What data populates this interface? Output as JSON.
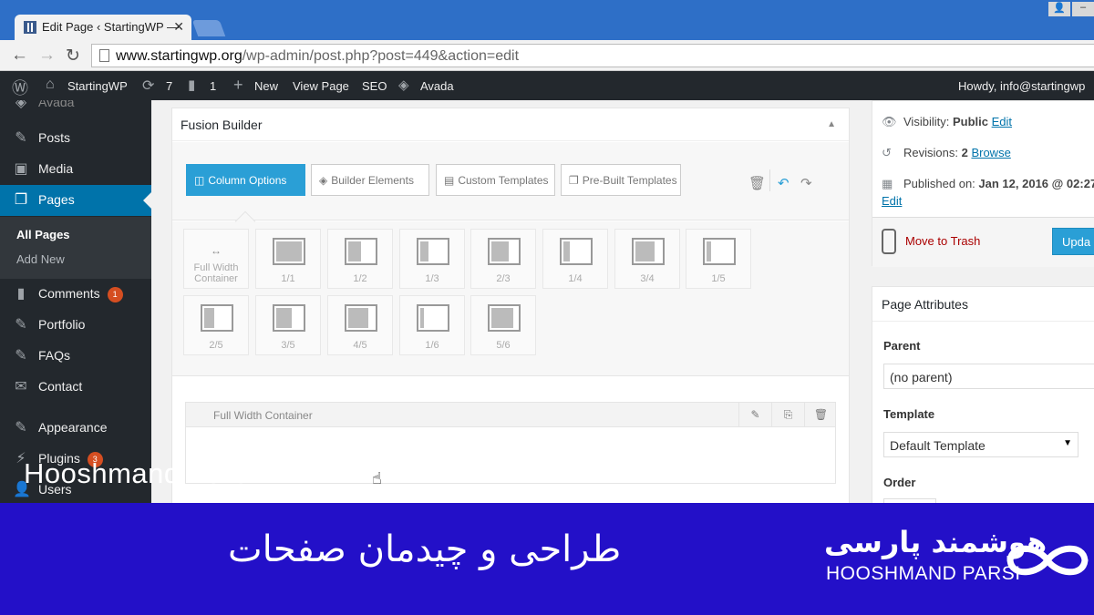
{
  "browser": {
    "tab_title": "Edit Page ‹ StartingWP —",
    "url_domain": "www.startingwp.org",
    "url_path": "/wp-admin/post.php?post=449&action=edit"
  },
  "adminbar": {
    "site": "StartingWP",
    "updates": "7",
    "comments": "1",
    "new": "New",
    "view_page": "View Page",
    "seo": "SEO",
    "avada": "Avada",
    "howdy": "Howdy, info@startingwp"
  },
  "sidebar": {
    "top_cut": "Avada",
    "items": [
      {
        "label": "Posts"
      },
      {
        "label": "Media"
      },
      {
        "label": "Pages"
      },
      {
        "label": "Comments",
        "badge": "1"
      },
      {
        "label": "Portfolio"
      },
      {
        "label": "FAQs"
      },
      {
        "label": "Contact"
      },
      {
        "label": "Appearance"
      },
      {
        "label": "Plugins",
        "badge": "3"
      },
      {
        "label": "Users"
      }
    ],
    "sub_all": "All Pages",
    "sub_add": "Add New"
  },
  "builder": {
    "title": "Fusion Builder",
    "btn_column": "Column Options",
    "btn_elements": "Builder Elements",
    "btn_custom": "Custom Templates",
    "btn_prebuilt": "Pre-Built Templates",
    "full_width_label": "Full Width Container",
    "columns": [
      "1/1",
      "1/2",
      "1/3",
      "2/3",
      "1/4",
      "3/4",
      "1/5",
      "2/5",
      "3/5",
      "4/5",
      "1/6",
      "5/6"
    ],
    "container_label": "Full Width Container"
  },
  "publish": {
    "visibility_label": "Visibility:",
    "visibility_value": "Public",
    "visibility_edit": "Edit",
    "revisions_label": "Revisions:",
    "revisions_value": "2",
    "revisions_browse": "Browse",
    "published_label": "Published on:",
    "published_value": "Jan 12, 2016 @ 02:27",
    "published_edit": "Edit",
    "trash": "Move to Trash",
    "update": "Upda"
  },
  "attributes": {
    "title": "Page Attributes",
    "parent_label": "Parent",
    "parent_value": "(no parent)",
    "template_label": "Template",
    "template_value": "Default Template",
    "order_label": "Order"
  },
  "watermark": "Hooshmand Parsi",
  "banner": {
    "title": "طراحی و چیدمان صفحات",
    "brand_fa": "هوشمند پارسی",
    "brand_en": "HOOSHMAND PARSI"
  }
}
